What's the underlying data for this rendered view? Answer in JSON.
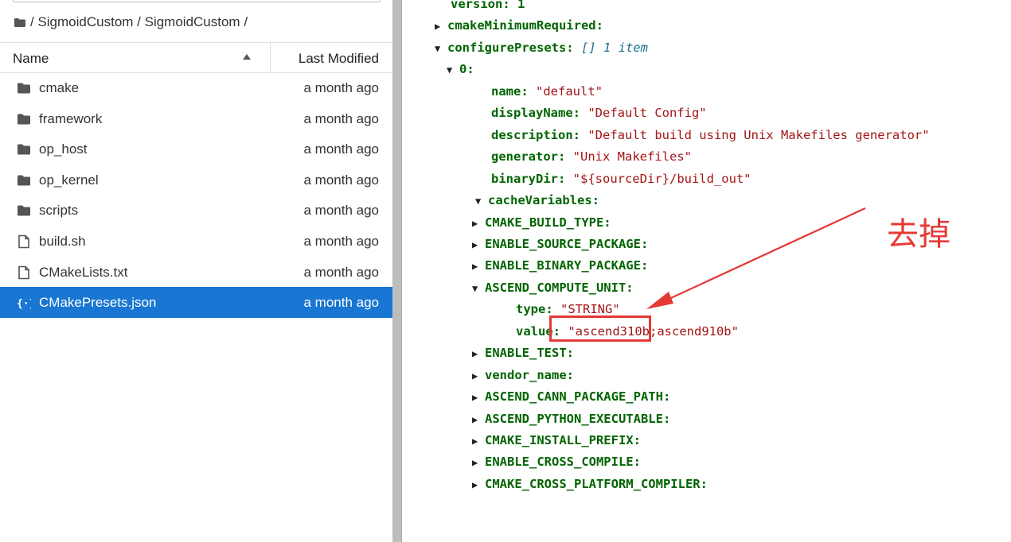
{
  "file_browser": {
    "breadcrumb": "/ SigmoidCustom / SigmoidCustom /",
    "columns": {
      "name": "Name",
      "modified": "Last Modified"
    },
    "files": [
      {
        "name": "cmake",
        "modified": "a month ago",
        "icon": "folder-icon",
        "selected": false
      },
      {
        "name": "framework",
        "modified": "a month ago",
        "icon": "folder-icon",
        "selected": false
      },
      {
        "name": "op_host",
        "modified": "a month ago",
        "icon": "folder-icon",
        "selected": false
      },
      {
        "name": "op_kernel",
        "modified": "a month ago",
        "icon": "folder-icon",
        "selected": false
      },
      {
        "name": "scripts",
        "modified": "a month ago",
        "icon": "folder-icon",
        "selected": false
      },
      {
        "name": "build.sh",
        "modified": "a month ago",
        "icon": "file-icon",
        "selected": false
      },
      {
        "name": "CMakeLists.txt",
        "modified": "a month ago",
        "icon": "file-icon",
        "selected": false
      },
      {
        "name": "CMakePresets.json",
        "modified": "a month ago",
        "icon": "json-icon",
        "selected": true
      }
    ]
  },
  "json_viewer": {
    "rows": [
      {
        "indent": 0,
        "toggle": "",
        "key": "version:",
        "value": "1",
        "value_type": "num"
      },
      {
        "indent": 0,
        "toggle": "▶",
        "key": "cmakeMinimumRequired:",
        "value": "",
        "value_type": ""
      },
      {
        "indent": 0,
        "toggle": "▼",
        "key": "configurePresets:",
        "value": "[] 1 item",
        "value_type": "meta"
      },
      {
        "indent": 1,
        "toggle": "▼",
        "key": "0:",
        "value": "",
        "value_type": ""
      },
      {
        "indent": 2,
        "toggle": "",
        "key": "name:",
        "value": "\"default\"",
        "value_type": "str"
      },
      {
        "indent": 2,
        "toggle": "",
        "key": "displayName:",
        "value": "\"Default Config\"",
        "value_type": "str"
      },
      {
        "indent": 2,
        "toggle": "",
        "key": "description:",
        "value": "\"Default build using Unix Makefiles generator\"",
        "value_type": "str"
      },
      {
        "indent": 2,
        "toggle": "",
        "key": "generator:",
        "value": "\"Unix Makefiles\"",
        "value_type": "str"
      },
      {
        "indent": 2,
        "toggle": "",
        "key": "binaryDir:",
        "value": "\"${sourceDir}/build_out\"",
        "value_type": "str"
      },
      {
        "indent": 2,
        "toggle": "▼",
        "key": "cacheVariables:",
        "value": "",
        "value_type": ""
      },
      {
        "indent": 3,
        "toggle": "▶",
        "key": "CMAKE_BUILD_TYPE:",
        "value": "",
        "value_type": ""
      },
      {
        "indent": 3,
        "toggle": "▶",
        "key": "ENABLE_SOURCE_PACKAGE:",
        "value": "",
        "value_type": ""
      },
      {
        "indent": 3,
        "toggle": "▶",
        "key": "ENABLE_BINARY_PACKAGE:",
        "value": "",
        "value_type": ""
      },
      {
        "indent": 3,
        "toggle": "▼",
        "key": "ASCEND_COMPUTE_UNIT:",
        "value": "",
        "value_type": ""
      },
      {
        "indent": 4,
        "toggle": "",
        "key": "type:",
        "value": "\"STRING\"",
        "value_type": "str"
      },
      {
        "indent": 4,
        "toggle": "",
        "key": "value:",
        "value": "\"ascend310b;ascend910b\"",
        "value_type": "str"
      },
      {
        "indent": 3,
        "toggle": "▶",
        "key": "ENABLE_TEST:",
        "value": "",
        "value_type": ""
      },
      {
        "indent": 3,
        "toggle": "▶",
        "key": "vendor_name:",
        "value": "",
        "value_type": ""
      },
      {
        "indent": 3,
        "toggle": "▶",
        "key": "ASCEND_CANN_PACKAGE_PATH:",
        "value": "",
        "value_type": ""
      },
      {
        "indent": 3,
        "toggle": "▶",
        "key": "ASCEND_PYTHON_EXECUTABLE:",
        "value": "",
        "value_type": ""
      },
      {
        "indent": 3,
        "toggle": "▶",
        "key": "CMAKE_INSTALL_PREFIX:",
        "value": "",
        "value_type": ""
      },
      {
        "indent": 3,
        "toggle": "▶",
        "key": "ENABLE_CROSS_COMPILE:",
        "value": "",
        "value_type": ""
      },
      {
        "indent": 3,
        "toggle": "▶",
        "key": "CMAKE_CROSS_PLATFORM_COMPILER:",
        "value": "",
        "value_type": ""
      }
    ]
  },
  "annotation": {
    "text": "去掉",
    "color": "#e53935"
  },
  "colors": {
    "selection": "#1976d2",
    "key": "#006400",
    "string": "#a31515",
    "meta": "#1a6f8c"
  }
}
